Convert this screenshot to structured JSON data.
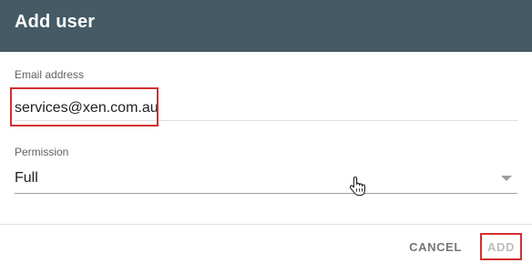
{
  "dialog": {
    "title": "Add user"
  },
  "email": {
    "label": "Email address",
    "value": "services@xen.com.au"
  },
  "permission": {
    "label": "Permission",
    "selected": "Full"
  },
  "actions": {
    "cancel_label": "CANCEL",
    "add_label": "ADD"
  },
  "colors": {
    "header_bg": "#455a64",
    "highlight": "#d32f2f"
  },
  "icons": {
    "dropdown": "chevron-down-icon",
    "cursor": "hand-pointer-cursor"
  }
}
